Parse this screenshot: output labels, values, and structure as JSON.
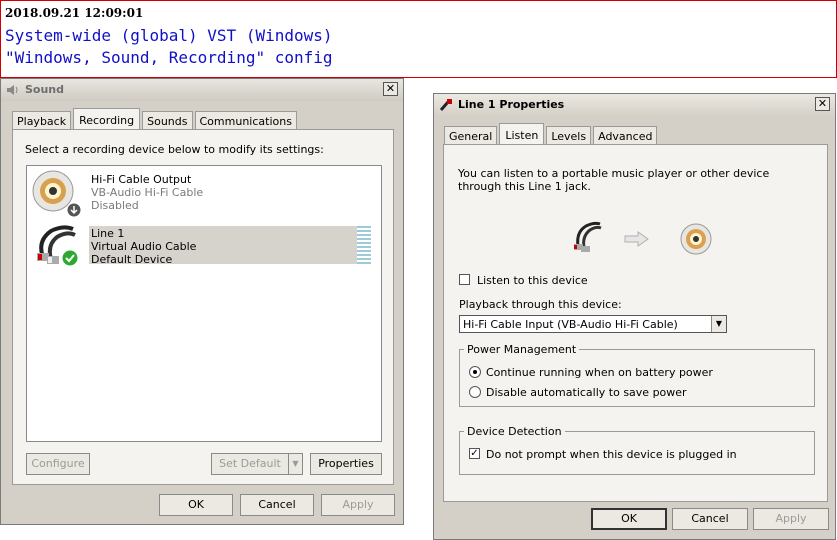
{
  "annotation": {
    "timestamp": "2018.09.21 12:09:01",
    "line1": "System-wide (global) VST (Windows)",
    "line2": "\"Windows, Sound, Recording\" config"
  },
  "sound_dialog": {
    "title": "Sound",
    "tabs": [
      "Playback",
      "Recording",
      "Sounds",
      "Communications"
    ],
    "active_tab": "Recording",
    "instruction": "Select a recording device below to modify its settings:",
    "devices": [
      {
        "name": "Hi-Fi Cable Output",
        "driver": "VB-Audio Hi-Fi Cable",
        "status": "Disabled",
        "badge": "down-arrow-icon"
      },
      {
        "name": "Line 1",
        "driver": "Virtual Audio Cable",
        "status": "Default Device",
        "badge": "green-check-icon"
      }
    ],
    "buttons": {
      "configure": "Configure",
      "set_default": "Set Default",
      "properties": "Properties",
      "ok": "OK",
      "cancel": "Cancel",
      "apply": "Apply"
    }
  },
  "properties_dialog": {
    "title": "Line 1 Properties",
    "tabs": [
      "General",
      "Listen",
      "Levels",
      "Advanced"
    ],
    "active_tab": "Listen",
    "description": "You can listen to a portable music player or other device through this Line 1 jack.",
    "listen_checkbox": {
      "label": "Listen to this device",
      "checked": false
    },
    "playback_label": "Playback through this device:",
    "playback_value": "Hi-Fi Cable Input (VB-Audio Hi-Fi Cable)",
    "power_group": {
      "title": "Power Management",
      "options": [
        "Continue running when on battery power",
        "Disable automatically to save power"
      ],
      "selected": 0
    },
    "detection_group": {
      "title": "Device Detection",
      "checkbox_label": "Do not prompt when this device is plugged in",
      "checked": true
    },
    "buttons": {
      "ok": "OK",
      "cancel": "Cancel",
      "apply": "Apply"
    }
  }
}
